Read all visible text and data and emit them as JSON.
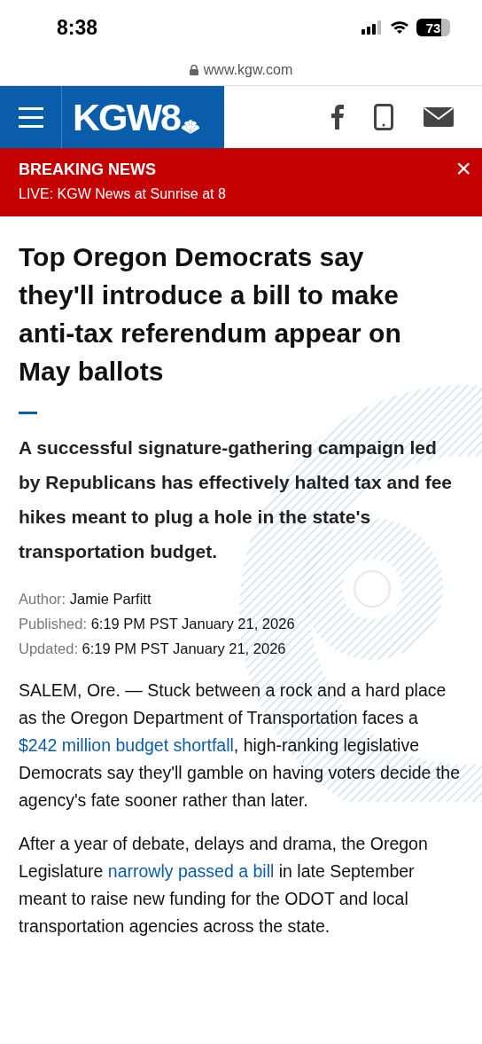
{
  "status_bar": {
    "time": "8:38",
    "battery": "73"
  },
  "address_bar": {
    "url": "www.kgw.com"
  },
  "header": {
    "logo": "KGW8"
  },
  "breaking": {
    "title": "BREAKING NEWS",
    "text": "LIVE: KGW News at Sunrise at 8",
    "close": "×"
  },
  "article": {
    "headline": "Top Oregon Democrats say they'll introduce a bill to make anti-tax referendum appear on May ballots",
    "dek": "A successful signature-gathering campaign led by Republicans has effectively halted tax and fee hikes meant to plug a hole in the state's transportation budget.",
    "meta": [
      {
        "label": "Author:",
        "value": "Jamie Parfitt"
      },
      {
        "label": "Published:",
        "value": "6:19 PM PST January 21, 2026"
      },
      {
        "label": "Updated:",
        "value": "6:19 PM PST January 21, 2026"
      }
    ],
    "paragraphs": [
      [
        {
          "text": "SALEM, Ore. — Stuck between a rock and a hard place as the Oregon Department of Transportation faces a ",
          "link": false
        },
        {
          "text": "$242 million budget shortfall",
          "link": true
        },
        {
          "text": ", high-ranking legislative Democrats say they'll gamble on having voters decide the agency's fate sooner rather than later.",
          "link": false
        }
      ],
      [
        {
          "text": "After a year of debate, delays and drama, the Oregon Legislature ",
          "link": false
        },
        {
          "text": "narrowly passed a bill",
          "link": true
        },
        {
          "text": " in late September meant to raise new funding for the ODOT and local transportation agencies across the state.",
          "link": false
        }
      ]
    ]
  }
}
